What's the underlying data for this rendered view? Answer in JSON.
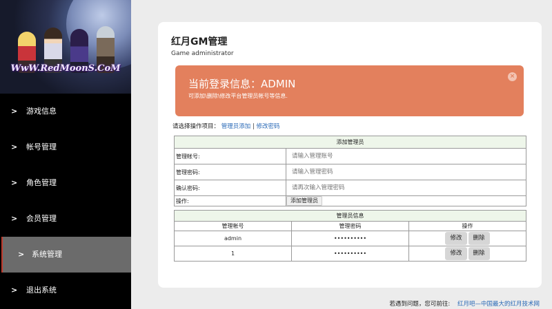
{
  "sidebar": {
    "logo_text": "WwW.RedMoonS.CoM",
    "items": [
      {
        "label": "游戏信息"
      },
      {
        "label": "帐号管理"
      },
      {
        "label": "角色管理"
      },
      {
        "label": "会员管理"
      },
      {
        "label": "系统管理"
      },
      {
        "label": "退出系统"
      }
    ]
  },
  "main": {
    "title": "红月GM管理",
    "subtitle": "Game administrator",
    "alert": {
      "heading": "当前登录信息：ADMIN",
      "text": "可添加\\删除\\修改平台管理员帐号等信息.",
      "close": "×"
    },
    "ops": {
      "prompt": "请选择操作项目：",
      "add_link": "管理员添加",
      "separator": "|",
      "pwd_link": "修改密码"
    },
    "add_form": {
      "header": "添加管理员",
      "account_label": "管理帐号:",
      "account_placeholder": "请输入管理账号",
      "password_label": "管理密码:",
      "password_placeholder": "请输入管理密码",
      "confirm_label": "确认密码:",
      "confirm_placeholder": "请再次输入管理密码",
      "action_label": "操作:",
      "submit_label": "添加管理员"
    },
    "admin_table": {
      "header": "管理员信息",
      "columns": [
        "管理帐号",
        "管理密码",
        "操作"
      ],
      "rows": [
        {
          "account": "admin",
          "password": "••••••••••",
          "edit": "修改",
          "delete": "删除"
        },
        {
          "account": "1",
          "password": "••••••••••",
          "edit": "修改",
          "delete": "删除"
        }
      ]
    }
  },
  "footer": {
    "text": "若遇到问题，您可前往:",
    "link": "红月吧—中国最大的红月技术网"
  }
}
